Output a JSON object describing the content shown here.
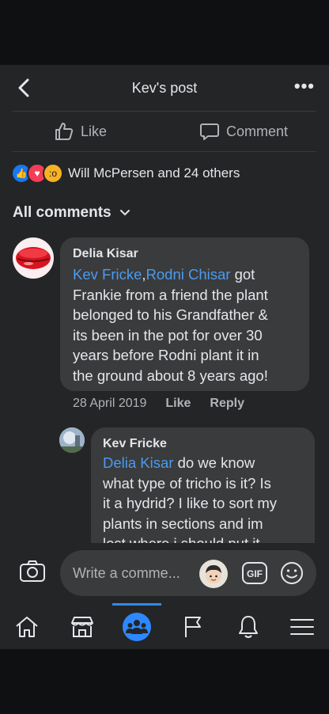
{
  "header": {
    "title": "Kev's post"
  },
  "actions": {
    "like_label": "Like",
    "comment_label": "Comment"
  },
  "reactions": {
    "icons": [
      "like-icon",
      "love-icon",
      "wow-icon"
    ],
    "summary": "Will McPersen and 24 others"
  },
  "comments_filter": {
    "label": "All comments"
  },
  "comments": [
    {
      "author": "Delia Kisar",
      "mention_1": "Kev Fricke",
      "separator": ",",
      "mention_2": "Rodni Chisar",
      "text_after_mention": " got",
      "lines": [
        "Frankie from a friend the plant",
        "belonged to his Grandfather &",
        "its been in the pot for over 30",
        "years before Rodni plant it in",
        "the ground about 8 years ago!"
      ],
      "date": "28 April 2019",
      "like_label": "Like",
      "reply_label": "Reply"
    },
    {
      "author": "Kev Fricke",
      "mention": "Delia Kisar",
      "text_after_mention": " do we know",
      "lines": [
        "what type of tricho is it? Is",
        "it a hydrid? I like to sort my",
        "plants in sections and im",
        "lost where i should put it"
      ]
    }
  ],
  "composer": {
    "placeholder": "Write a comme...",
    "gif_label": "GIF"
  },
  "tabbar": {
    "items": [
      "home-icon",
      "marketplace-icon",
      "groups-icon",
      "pages-icon",
      "notifications-icon",
      "menu-icon"
    ],
    "active_color": "#2d88ff"
  },
  "colors": {
    "mention": "#4a9bf0",
    "background": "#242527",
    "bubble": "#3a3b3c"
  }
}
